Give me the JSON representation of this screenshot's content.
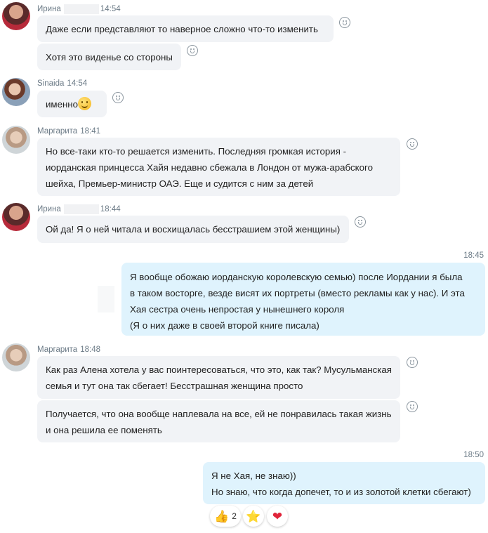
{
  "messages": [
    {
      "sender": "Ирина",
      "time": "14:54",
      "text": "Даже если представляют то наверное сложно что-то изменить"
    },
    {
      "text": "Хотя это виденье со стороны"
    },
    {
      "sender": "Sinaida",
      "time": "14:54",
      "text": "именно"
    },
    {
      "sender": "Маргарита",
      "time": "18:41",
      "lines": [
        "Но все-таки кто-то решается изменить. Последняя громкая история -",
        "иорданская принцесса Хайя недавно сбежала в Лондон от мужа-арабского",
        "шейха, Премьер-министр ОАЭ. Еще и судится с ним за детей"
      ]
    },
    {
      "sender": "Ирина",
      "time": "18:44",
      "text": "Ой да! Я о ней читала и восхищалась бесстрашием этой женщины)"
    },
    {
      "time": "18:45",
      "lines": [
        "Я вообще обожаю иорданскую королевскую семью) после Иордании я была",
        "в таком восторге, везде висят их портреты (вместо рекламы как у нас). И эта",
        "Хая сестра очень непростая у нынешнего короля",
        "(Я о них даже в своей второй книге писала)"
      ]
    },
    {
      "sender": "Маргарита",
      "time": "18:48",
      "lines": [
        "Как раз Алена хотела у вас поинтересоваться, что это, как так? Мусульманская",
        "семья и тут она так сбегает! Бесстрашная женщина просто"
      ]
    },
    {
      "lines": [
        "Получается, что она вообще наплевала на все, ей не понравилась такая жизнь",
        "и она решила ее поменять"
      ]
    },
    {
      "time": "18:50",
      "lines": [
        "Я не Хая, не знаю))",
        "Но знаю, что когда допечет, то и из золотой клетки сбегают)"
      ]
    }
  ],
  "reactions": [
    {
      "emoji": "👍",
      "count": "2"
    },
    {
      "emoji": "⭐"
    },
    {
      "emoji": "❤"
    }
  ]
}
